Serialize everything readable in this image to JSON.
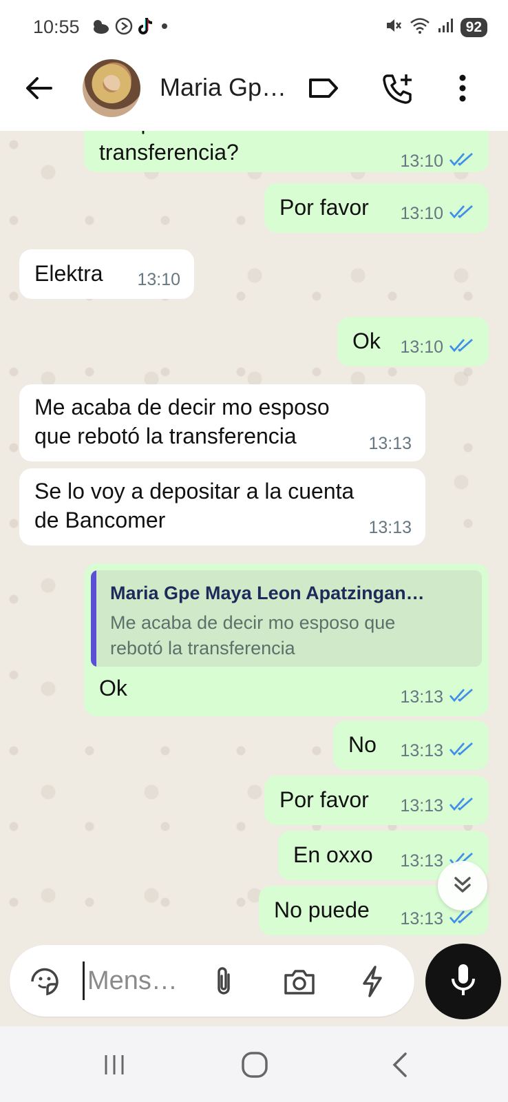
{
  "status_bar": {
    "time": "10:55",
    "battery": "92",
    "left_icons": [
      "weather-icon",
      "pause-circle-icon",
      "tiktok-icon",
      "dot-icon"
    ],
    "right_icons": [
      "mute-icon",
      "wifi-icon",
      "signal-icon",
      "battery-icon"
    ]
  },
  "header": {
    "contact_name": "Maria Gp…",
    "icons": [
      "back-arrow-icon",
      "label-icon",
      "add-call-icon",
      "more-vert-icon"
    ]
  },
  "messages": [
    {
      "direction": "outgoing",
      "text_partial_top": "De que banco fue la",
      "text": "transferencia?",
      "time": "13:10",
      "status": "read"
    },
    {
      "direction": "outgoing",
      "text": "Por favor",
      "time": "13:10",
      "status": "read"
    },
    {
      "direction": "incoming",
      "text": "Elektra",
      "time": "13:10"
    },
    {
      "direction": "outgoing",
      "text": "Ok",
      "time": "13:10",
      "status": "read"
    },
    {
      "direction": "incoming",
      "text_line1": "Me acaba de decir mo esposo",
      "text_line2": "que rebotó la transferencia",
      "time": "13:13"
    },
    {
      "direction": "incoming",
      "text_line1": "Se lo voy a depositar a la cuenta",
      "text_line2": "de Bancomer",
      "time": "13:13"
    },
    {
      "direction": "outgoing",
      "reply": {
        "author": "Maria Gpe Maya Leon Apatzingan…",
        "text_line1": "Me acaba de decir mo esposo que",
        "text_line2": "rebotó la transferencia"
      },
      "text": "Ok",
      "time": "13:13",
      "status": "read"
    },
    {
      "direction": "outgoing",
      "text": "No",
      "time": "13:13",
      "status": "read"
    },
    {
      "direction": "outgoing",
      "text": "Por favor",
      "time": "13:13",
      "status": "read"
    },
    {
      "direction": "outgoing",
      "text": "En oxxo",
      "time": "13:13",
      "status": "read"
    },
    {
      "direction": "outgoing",
      "text": "No puede",
      "time": "13:13",
      "status": "read"
    }
  ],
  "input": {
    "placeholder": "Mens…",
    "icons": [
      "sticker-icon",
      "attach-icon",
      "camera-icon",
      "flash-icon",
      "mic-icon"
    ]
  },
  "nav_bar": {
    "icons": [
      "recents-icon",
      "home-icon",
      "back-icon"
    ]
  },
  "colors": {
    "outgoing_bubble": "#d9fdd3",
    "incoming_bubble": "#ffffff",
    "chat_background": "#efeae2",
    "read_ticks": "#3f8fe8",
    "reply_bar": "#5b4fd6"
  }
}
